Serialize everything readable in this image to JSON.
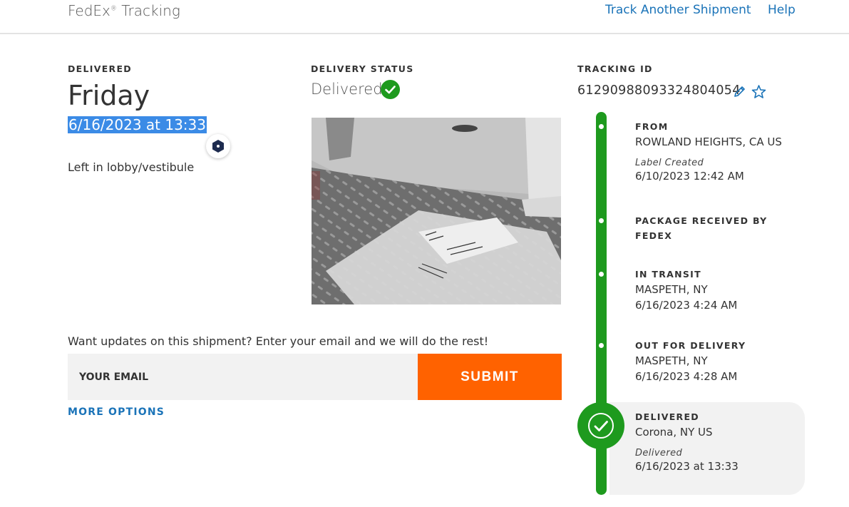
{
  "header": {
    "brand": "FedEx",
    "brand_mark": "®",
    "brand_suffix": "Tracking",
    "track_another": "Track Another Shipment",
    "help": "Help"
  },
  "delivery_date": {
    "label": "DELIVERED",
    "day": "Friday",
    "datetime": "6/16/2023 at 13:33",
    "location_note": "Left in lobby/vestibule"
  },
  "delivery_status": {
    "label": "DELIVERY STATUS",
    "value": "Delivered",
    "icon": "check-circle-icon",
    "photo_icon": "delivery-photo"
  },
  "tracking": {
    "label": "TRACKING ID",
    "number": "612909880933248040​54",
    "edit_icon": "pencil-icon",
    "favorite_icon": "star-icon"
  },
  "updates": {
    "prompt": "Want updates on this shipment? Enter your email and we will do the rest!",
    "email_placeholder": "YOUR EMAIL",
    "submit_label": "SUBMIT",
    "more_options": "MORE OPTIONS"
  },
  "timeline": [
    {
      "title": "FROM",
      "location": "ROWLAND HEIGHTS, CA US",
      "note": "Label Created",
      "time": "6/10/2023 12:42 AM"
    },
    {
      "title": "PACKAGE RECEIVED BY",
      "title2": "FEDEX"
    },
    {
      "title": "IN TRANSIT",
      "location": "MASPETH, NY",
      "time": "6/16/2023 4:24 AM"
    },
    {
      "title": "OUT FOR DELIVERY",
      "location": "MASPETH, NY",
      "time": "6/16/2023 4:28 AM"
    },
    {
      "title": "DELIVERED",
      "location": "Corona, NY US",
      "note": "Delivered",
      "time": "6/16/2023 at 13:33"
    }
  ],
  "colors": {
    "brand_orange": "#ff6200",
    "status_green": "#1e9a1e",
    "link_blue": "#1a73b8",
    "selection_blue": "#3b8be6"
  }
}
